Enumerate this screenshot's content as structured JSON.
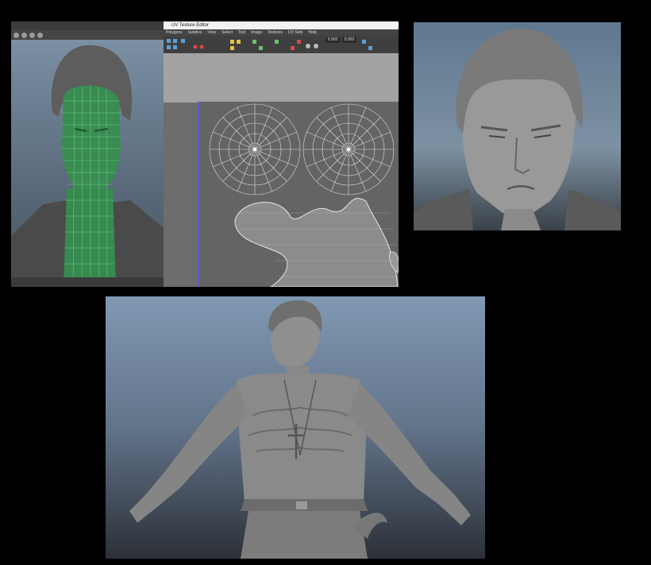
{
  "uv_editor": {
    "title": "UV Texture Editor",
    "menu": [
      "Polygons",
      "Subdivs",
      "View",
      "Select",
      "Tool",
      "Image",
      "Textures",
      "UV Sets",
      "Help"
    ],
    "field_1": "0.000",
    "field_2": "0.000"
  },
  "colors": {
    "wireframe": "#3ee07a",
    "viewport_top": "#7f95aa",
    "sculpt_gray": "#8f8f8f"
  }
}
